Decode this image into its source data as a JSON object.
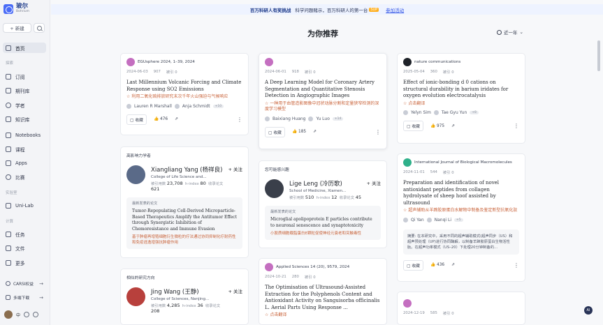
{
  "brand": {
    "name": "玻尔",
    "sub": "Bohrium"
  },
  "sidebar": {
    "new_label": "+ 新建",
    "home": "首页",
    "sec_discover": "探索",
    "items_discover": [
      "订阅",
      "期刊库",
      "学者",
      "知识库",
      "Notebooks",
      "课程",
      "Apps",
      "比赛"
    ],
    "sec_lab": "实验室",
    "lab": "Uni-Lab",
    "sec_compute": "计算",
    "items_compute": [
      "任务",
      "文件",
      "更多"
    ],
    "cards": "CARSI权益",
    "download": "多端下载",
    "lang": "中"
  },
  "banner": {
    "bold": "百万科研人有奖挑战",
    "text": "科学问题赌示，百万科研人的第一台",
    "tag": "SUP",
    "link": "参加活动"
  },
  "page_title": "为你推荐",
  "time_filter": "近一年",
  "col1": {
    "p1": {
      "source": "EGUsphere 2024, 1–39, 2024",
      "date": "2024-06-03",
      "views": "907",
      "cites": "被引 0",
      "title": "Last Millennium Volcanic Forcing and Climate Response using SO2 Emissions",
      "trans": "利用二氧化硫排放研究末次千年火山强迫与气候响应",
      "a1": "Lauren R Marshall",
      "a2": "Anja Schmidt",
      "more": "+10",
      "save": "收藏",
      "likes": "476"
    },
    "scholars": {
      "heading": "高影响力学者",
      "name": "Xiangliang Yang (杨祥良)",
      "inst": "College of Life Science and...",
      "cites_lbl": "被引用数",
      "cites": "23,708",
      "h_lbl": "h-index",
      "h": "80",
      "papers_lbl": "收录论文",
      "papers": "621",
      "follow": "+ 关注",
      "recent": "最新发表的论文",
      "ptitle": "Tumor-Repopulating Cell-Derived Microparticle-Based Therapeutics Amplify the Antitumor Effect through Synergistic Inhibition of Chemoresistance and Immune Evasion",
      "ptrans": "基于肿瘤再增殖细胞衍生微粒的疗法通过协同抑制化疗耐药性和免疫逃逸增强抗肿瘤作用"
    },
    "similar": {
      "heading": "相似的研究方向",
      "name": "Jing Wang (王静)",
      "inst": "College of Sciences, Nanjing...",
      "cites_lbl": "被引用数",
      "cites": "4,285",
      "h_lbl": "h-index",
      "h": "36",
      "papers_lbl": "收录论文",
      "papers": "208",
      "follow": "+ 关注"
    }
  },
  "col2": {
    "p1": {
      "date": "2024-06-01",
      "views": "918",
      "cites": "被引 0",
      "title": "A Deep Learning Model for Coronary Artery Segmentation and Quantitative Stenosis Detection in Angiographic Images",
      "trans": "一种用于血管造影图像中冠状动脉分割和定量狭窄检测的深度学习模型",
      "a1": "Baixiang Huang",
      "a2": "Yu Luo",
      "more": "+14",
      "save": "收藏",
      "likes": "185"
    },
    "maybe": {
      "heading": "您可能感兴趣",
      "name": "Lige Leng (冷历歌)",
      "inst": "School of Medicine, Xiamen...",
      "cites_lbl": "被引用数",
      "cites": "510",
      "h_lbl": "h-index",
      "h": "12",
      "papers_lbl": "收录论文",
      "papers": "45",
      "follow": "+ 关注",
      "recent": "最新发表的论文",
      "ptitle": "Microglial apolipoprotein E particles contribute to neuronal senescence and synaptotoxicity",
      "ptrans": "小胶质细胞载脂蛋白E颗粒促使神经元衰老和突触毒性"
    },
    "p2": {
      "source": "Applied Sciences 14 (20), 9579, 2024",
      "date": "2024-10-21",
      "views": "280",
      "cites": "被引 0",
      "title": "The Optimisation of Ultrasound-Assisted Extraction for the Polyphenols Content and Antioxidant Activity on Sanguisorba officinalis L. Aerial Parts Using Response ...",
      "trans": "点击翻译"
    }
  },
  "col3": {
    "p1": {
      "source": "nature communications",
      "date": "2025-05-04",
      "views": "360",
      "cites": "被引 0",
      "title": "Effect of ionic-bonding d 0 cations on structural durability in barium iridates for oxygen evolution electrocatalysis",
      "trans": "点击翻译",
      "a1": "Yelyn Sim",
      "a2": "Tae Gyu Yun",
      "more": "+8",
      "save": "收藏",
      "likes": "975"
    },
    "p2": {
      "source": "International Journal of Biological Macromolecules",
      "date": "2024-11-01",
      "views": "544",
      "cites": "被引 0",
      "title": "Preparation and identification of novel antioxidant peptides from collagen hydrolysate of sheep hoof assisted by ultrasound",
      "trans": "超声辅助从羊蹄胶原蛋白水解物中制备及鉴定新型抗氧化肽",
      "a1": "Qi Yan",
      "a2": "Nanqi Li",
      "more": "+5",
      "abstract": "摘要: 在本研究中，采用不同的超声辅助模式(超声同步（US）和超声预处理（UP)进行协同酶解，以制备羊蹄胶原蛋白生物活性肽。在超声功率模式（US–20）下处理20分钟制备的...",
      "save": "收藏",
      "likes": "436"
    },
    "p3": {
      "date": "2024-12-19",
      "views": "585",
      "cites": "被引 0"
    }
  },
  "colors": {
    "accent": "#3658e6",
    "translate": "#c9643b",
    "brand": "#1d3a8a"
  }
}
